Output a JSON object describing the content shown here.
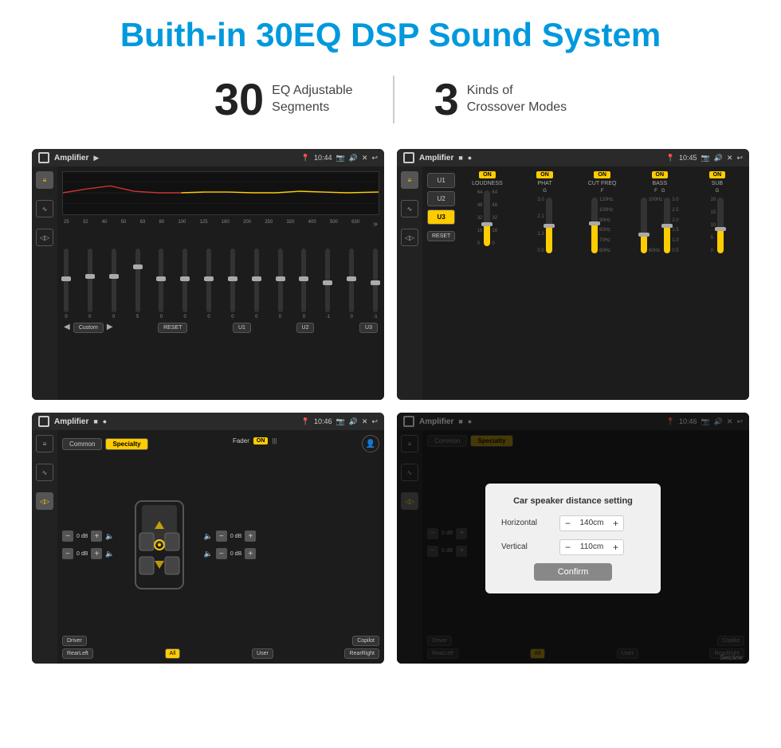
{
  "page": {
    "title": "Buith-in 30EQ DSP Sound System",
    "stats": [
      {
        "number": "30",
        "label": "EQ Adjustable\nSegments"
      },
      {
        "number": "3",
        "label": "Kinds of\nCrossover Modes"
      }
    ],
    "app_name": "Amplifier",
    "time1": "10:44",
    "time2": "10:45",
    "time3": "10:46",
    "time4": "10:46",
    "eq_freqs": [
      "25",
      "32",
      "40",
      "50",
      "63",
      "80",
      "100",
      "125",
      "160",
      "200",
      "250",
      "320",
      "400",
      "500",
      "630"
    ],
    "eq_values": [
      "0",
      "0",
      "0",
      "5",
      "0",
      "0",
      "0",
      "0",
      "0",
      "0",
      "0",
      "-1",
      "0",
      "-1"
    ],
    "eq_presets": [
      "Custom",
      "RESET",
      "U1",
      "U2",
      "U3"
    ],
    "dsp_channels": [
      "LOUDNESS",
      "PHAT",
      "CUT FREQ",
      "BASS",
      "SUB"
    ],
    "presets": [
      "U1",
      "U2",
      "U3"
    ],
    "speaker_tabs": [
      "Common",
      "Specialty"
    ],
    "speaker_positions": [
      "Driver",
      "RearLeft",
      "All",
      "User",
      "RearRight",
      "Copilot"
    ],
    "fader_label": "Fader",
    "dialog": {
      "title": "Car speaker distance setting",
      "horizontal_label": "Horizontal",
      "horizontal_value": "140cm",
      "vertical_label": "Vertical",
      "vertical_value": "110cm",
      "confirm_label": "Confirm"
    },
    "watermark": "Seicane"
  }
}
